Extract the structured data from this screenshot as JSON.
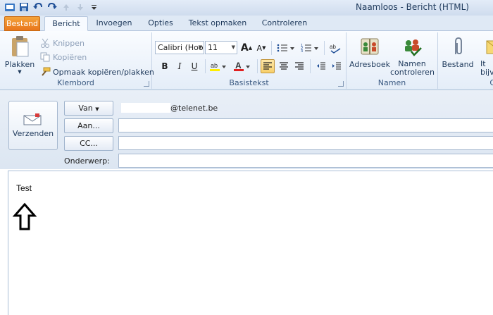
{
  "window": {
    "title": "Naamloos  -  Bericht (HTML)"
  },
  "tabs": [
    {
      "label": "Bestand"
    },
    {
      "label": "Bericht"
    },
    {
      "label": "Invoegen"
    },
    {
      "label": "Opties"
    },
    {
      "label": "Tekst opmaken"
    },
    {
      "label": "Controleren"
    }
  ],
  "ribbon": {
    "clipboard": {
      "group_label": "Klembord",
      "paste_label": "Plakken",
      "cut_label": "Knippen",
      "copy_label": "Kopiëren",
      "format_painter_label": "Opmaak kopiëren/plakken"
    },
    "basic_text": {
      "group_label": "Basistekst",
      "font_name": "Calibri (Hoo",
      "font_size": "11",
      "bold": "B",
      "italic": "I",
      "underline": "U",
      "grow": "A",
      "shrink": "A"
    },
    "names": {
      "group_label": "Namen",
      "address_book_label": "Adresboek",
      "check_names_label": "Namen controleren"
    },
    "include": {
      "group_label": "O",
      "attach_file_label": "Bestand",
      "attach_item_label": "It bijvo"
    }
  },
  "compose": {
    "send_label": "Verzenden",
    "from_label": "Van",
    "from_value": "@telenet.be",
    "to_label": "Aan...",
    "cc_label": "CC...",
    "subject_label": "Onderwerp:",
    "to_value": "",
    "cc_value": "",
    "subject_value": ""
  },
  "body": {
    "text": "Test"
  },
  "colors": {
    "accent_file_tab": "#e9761c",
    "ribbon_bg": "#e4edf8",
    "highlight": "#f8cf6a",
    "font_color": "#e02020"
  }
}
